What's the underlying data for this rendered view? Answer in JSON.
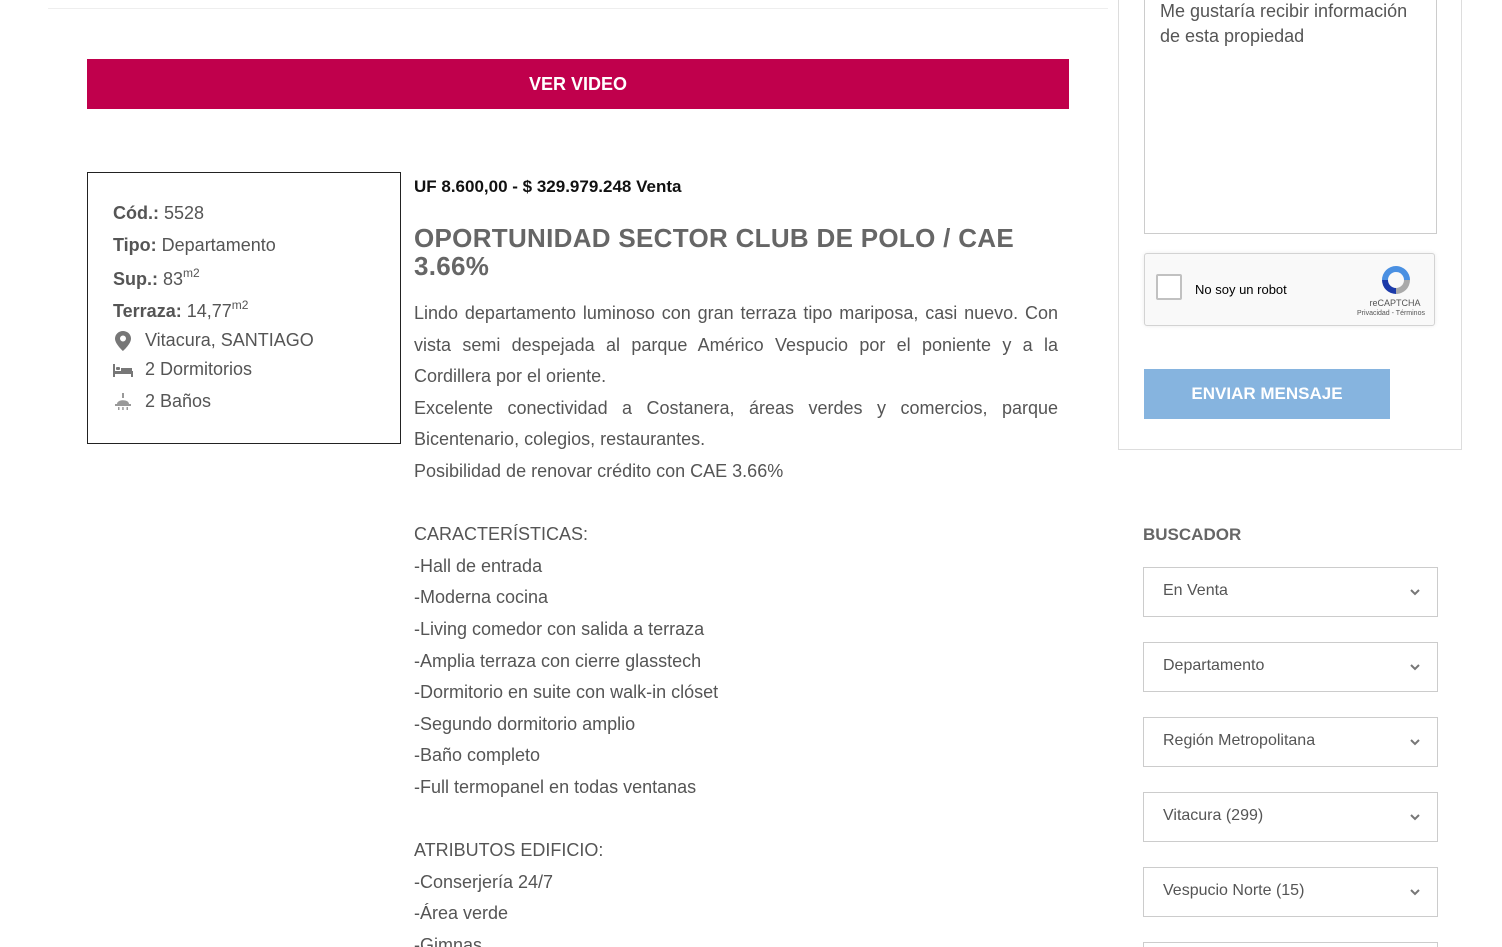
{
  "video_button": {
    "label": "VER VIDEO"
  },
  "property": {
    "code_label": "Cód.:",
    "code_value": " 5528",
    "type_label": "Tipo:",
    "type_value": " Departamento",
    "surface_label": "Sup.:",
    "surface_value": " 83",
    "surface_unit": "m2",
    "terrace_label": "Terraza:",
    "terrace_value": " 14,77",
    "terrace_unit": "m2",
    "location": "Vitacura, SANTIAGO",
    "bedrooms": "2  Dormitorios",
    "bathrooms": "2 Baños"
  },
  "price": "UF 8.600,00 - $ 329.979.248 Venta",
  "title": "OPORTUNIDAD SECTOR CLUB DE POLO / CAE 3.66%",
  "description": {
    "p1": "Lindo departamento luminoso con gran terraza tipo mariposa, casi nuevo. Con vista semi despejada al parque Américo Vespucio por el poniente y a la Cordillera por el oriente.",
    "p2": "Excelente conectividad a Costanera, áreas verdes y comercios, parque Bicentenario, colegios, restaurantes.",
    "p3": "Posibilidad de renovar crédito con CAE 3.66%",
    "features_heading": "CARACTERÍSTICAS:",
    "features": [
      "-Hall de entrada",
      "-Moderna cocina",
      "-Living comedor con salida a terraza",
      "-Amplia terraza con cierre glasstech",
      "-Dormitorio en suite con walk-in clóset",
      "-Segundo dormitorio amplio",
      "-Baño completo",
      "-Full termopanel en todas ventanas"
    ],
    "building_heading": "ATRIBUTOS EDIFICIO:",
    "building": [
      "-Conserjería 24/7",
      "-Área verde",
      "-Gimnas"
    ]
  },
  "contact_form": {
    "message": "Me gustaría recibir información de esta propiedad",
    "captcha_label": "No soy un robot",
    "captcha_brand": "reCAPTCHA",
    "captcha_terms": "Privacidad - Términos",
    "send_label": "ENVIAR MENSAJE"
  },
  "search": {
    "heading": "BUSCADOR",
    "selects": [
      "En Venta",
      "Departamento",
      "Región Metropolitana",
      "Vitacura (299)",
      "Vespucio Norte (15)"
    ]
  },
  "colors": {
    "accent": "#c0004c",
    "send_button": "#86b4df"
  },
  "icons": [
    "map-pin-icon",
    "bed-icon",
    "shower-icon",
    "recaptcha-icon",
    "chevron-down-icon"
  ]
}
